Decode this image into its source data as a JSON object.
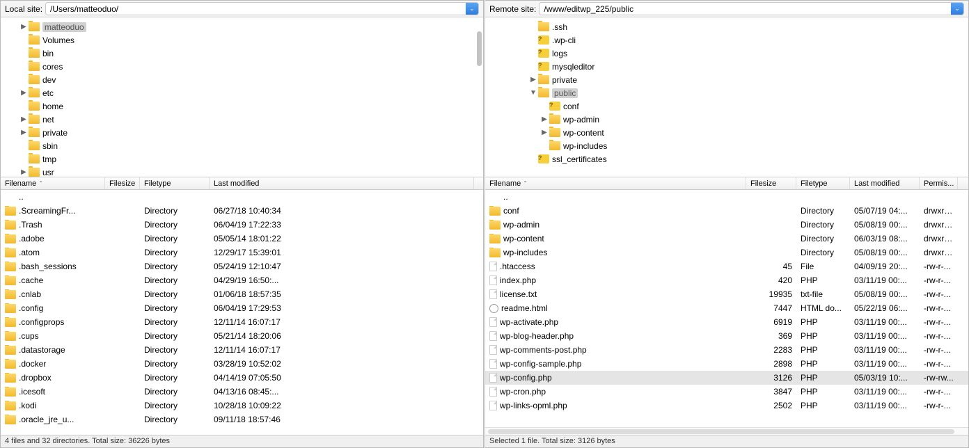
{
  "left": {
    "pathLabel": "Local site:",
    "pathValue": "/Users/matteoduo/",
    "tree": [
      {
        "indent": 28,
        "disc": "▶",
        "icon": "folder",
        "label": "matteoduo",
        "selected": true
      },
      {
        "indent": 28,
        "disc": "",
        "icon": "folder",
        "label": "Volumes"
      },
      {
        "indent": 28,
        "disc": "",
        "icon": "folder",
        "label": "bin"
      },
      {
        "indent": 28,
        "disc": "",
        "icon": "folder",
        "label": "cores"
      },
      {
        "indent": 28,
        "disc": "",
        "icon": "folder",
        "label": "dev"
      },
      {
        "indent": 28,
        "disc": "▶",
        "icon": "folder",
        "label": "etc"
      },
      {
        "indent": 28,
        "disc": "",
        "icon": "folder",
        "label": "home"
      },
      {
        "indent": 28,
        "disc": "▶",
        "icon": "folder",
        "label": "net"
      },
      {
        "indent": 28,
        "disc": "▶",
        "icon": "folder",
        "label": "private"
      },
      {
        "indent": 28,
        "disc": "",
        "icon": "folder",
        "label": "sbin"
      },
      {
        "indent": 28,
        "disc": "",
        "icon": "folder",
        "label": "tmp"
      },
      {
        "indent": 28,
        "disc": "▶",
        "icon": "folder",
        "label": "usr"
      }
    ],
    "columns": {
      "filename": "Filename",
      "filesize": "Filesize",
      "filetype": "Filetype",
      "lastmod": "Last modified"
    },
    "colWidths": {
      "filename": 150,
      "filesize": 50,
      "filetype": 100,
      "lastmod": 380
    },
    "files": [
      {
        "name": "..",
        "icon": "",
        "size": "",
        "type": "",
        "mod": ""
      },
      {
        "name": ".ScreamingFr...",
        "icon": "folder",
        "size": "",
        "type": "Directory",
        "mod": "06/27/18 10:40:34"
      },
      {
        "name": ".Trash",
        "icon": "folder",
        "size": "",
        "type": "Directory",
        "mod": "06/04/19 17:22:33"
      },
      {
        "name": ".adobe",
        "icon": "folder",
        "size": "",
        "type": "Directory",
        "mod": "05/05/14 18:01:22"
      },
      {
        "name": ".atom",
        "icon": "folder",
        "size": "",
        "type": "Directory",
        "mod": "12/29/17 15:39:01"
      },
      {
        "name": ".bash_sessions",
        "icon": "folder",
        "size": "",
        "type": "Directory",
        "mod": "05/24/19 12:10:47"
      },
      {
        "name": ".cache",
        "icon": "folder",
        "size": "",
        "type": "Directory",
        "mod": "04/29/19 16:50:..."
      },
      {
        "name": ".cnlab",
        "icon": "folder",
        "size": "",
        "type": "Directory",
        "mod": "01/06/18 18:57:35"
      },
      {
        "name": ".config",
        "icon": "folder",
        "size": "",
        "type": "Directory",
        "mod": "06/04/19 17:29:53"
      },
      {
        "name": ".configprops",
        "icon": "folder",
        "size": "",
        "type": "Directory",
        "mod": "12/11/14 16:07:17"
      },
      {
        "name": ".cups",
        "icon": "folder",
        "size": "",
        "type": "Directory",
        "mod": "05/21/14 18:20:06"
      },
      {
        "name": ".datastorage",
        "icon": "folder",
        "size": "",
        "type": "Directory",
        "mod": "12/11/14 16:07:17"
      },
      {
        "name": ".docker",
        "icon": "folder",
        "size": "",
        "type": "Directory",
        "mod": "03/28/19 10:52:02"
      },
      {
        "name": ".dropbox",
        "icon": "folder",
        "size": "",
        "type": "Directory",
        "mod": "04/14/19 07:05:50"
      },
      {
        "name": ".icesoft",
        "icon": "folder",
        "size": "",
        "type": "Directory",
        "mod": "04/13/16 08:45:..."
      },
      {
        "name": ".kodi",
        "icon": "folder",
        "size": "",
        "type": "Directory",
        "mod": "10/28/18 10:09:22"
      },
      {
        "name": ".oracle_jre_u...",
        "icon": "folder",
        "size": "",
        "type": "Directory",
        "mod": "09/11/18 18:57:46"
      }
    ],
    "status": "4 files and 32 directories. Total size: 36226 bytes"
  },
  "right": {
    "pathLabel": "Remote site:",
    "pathValue": "/www/editwp_225/public",
    "tree": [
      {
        "indent": 64,
        "disc": "",
        "icon": "folder",
        "label": ".ssh"
      },
      {
        "indent": 64,
        "disc": "",
        "icon": "q",
        "label": ".wp-cli"
      },
      {
        "indent": 64,
        "disc": "",
        "icon": "q",
        "label": "logs"
      },
      {
        "indent": 64,
        "disc": "",
        "icon": "q",
        "label": "mysqleditor"
      },
      {
        "indent": 64,
        "disc": "▶",
        "icon": "folder",
        "label": "private"
      },
      {
        "indent": 64,
        "disc": "▼",
        "icon": "folder",
        "label": "public",
        "selected": true
      },
      {
        "indent": 80,
        "disc": "",
        "icon": "q",
        "label": "conf"
      },
      {
        "indent": 80,
        "disc": "▶",
        "icon": "folder",
        "label": "wp-admin"
      },
      {
        "indent": 80,
        "disc": "▶",
        "icon": "folder",
        "label": "wp-content"
      },
      {
        "indent": 80,
        "disc": "",
        "icon": "folder",
        "label": "wp-includes"
      },
      {
        "indent": 64,
        "disc": "",
        "icon": "q",
        "label": "ssl_certificates"
      }
    ],
    "columns": {
      "filename": "Filename",
      "filesize": "Filesize",
      "filetype": "Filetype",
      "lastmod": "Last modified",
      "perms": "Permis..."
    },
    "colWidths": {
      "filename": 375,
      "filesize": 72,
      "filetype": 77,
      "lastmod": 100,
      "perms": 55
    },
    "files": [
      {
        "name": "..",
        "icon": "",
        "size": "",
        "type": "",
        "mod": "",
        "perm": ""
      },
      {
        "name": "conf",
        "icon": "folder",
        "size": "",
        "type": "Directory",
        "mod": "05/07/19 04:...",
        "perm": "drwxr-..."
      },
      {
        "name": "wp-admin",
        "icon": "folder",
        "size": "",
        "type": "Directory",
        "mod": "05/08/19 00:...",
        "perm": "drwxr-..."
      },
      {
        "name": "wp-content",
        "icon": "folder",
        "size": "",
        "type": "Directory",
        "mod": "06/03/19 08:...",
        "perm": "drwxr-..."
      },
      {
        "name": "wp-includes",
        "icon": "folder",
        "size": "",
        "type": "Directory",
        "mod": "05/08/19 00:...",
        "perm": "drwxr-..."
      },
      {
        "name": ".htaccess",
        "icon": "file",
        "size": "45",
        "type": "File",
        "mod": "04/09/19 20:...",
        "perm": "-rw-r-..."
      },
      {
        "name": "index.php",
        "icon": "file",
        "size": "420",
        "type": "PHP",
        "mod": "03/11/19 00:...",
        "perm": "-rw-r-..."
      },
      {
        "name": "license.txt",
        "icon": "file",
        "size": "19935",
        "type": "txt-file",
        "mod": "05/08/19 00:...",
        "perm": "-rw-r-..."
      },
      {
        "name": "readme.html",
        "icon": "html",
        "size": "7447",
        "type": "HTML do...",
        "mod": "05/22/19 06:...",
        "perm": "-rw-r-..."
      },
      {
        "name": "wp-activate.php",
        "icon": "file",
        "size": "6919",
        "type": "PHP",
        "mod": "03/11/19 00:...",
        "perm": "-rw-r-..."
      },
      {
        "name": "wp-blog-header.php",
        "icon": "file",
        "size": "369",
        "type": "PHP",
        "mod": "03/11/19 00:...",
        "perm": "-rw-r-..."
      },
      {
        "name": "wp-comments-post.php",
        "icon": "file",
        "size": "2283",
        "type": "PHP",
        "mod": "03/11/19 00:...",
        "perm": "-rw-r-..."
      },
      {
        "name": "wp-config-sample.php",
        "icon": "file",
        "size": "2898",
        "type": "PHP",
        "mod": "03/11/19 00:...",
        "perm": "-rw-r-..."
      },
      {
        "name": "wp-config.php",
        "icon": "file",
        "size": "3126",
        "type": "PHP",
        "mod": "05/03/19 10:...",
        "perm": "-rw-rw...",
        "selected": true
      },
      {
        "name": "wp-cron.php",
        "icon": "file",
        "size": "3847",
        "type": "PHP",
        "mod": "03/11/19 00:...",
        "perm": "-rw-r-..."
      },
      {
        "name": "wp-links-opml.php",
        "icon": "file",
        "size": "2502",
        "type": "PHP",
        "mod": "03/11/19 00:...",
        "perm": "-rw-r-..."
      }
    ],
    "status": "Selected 1 file. Total size: 3126 bytes"
  }
}
